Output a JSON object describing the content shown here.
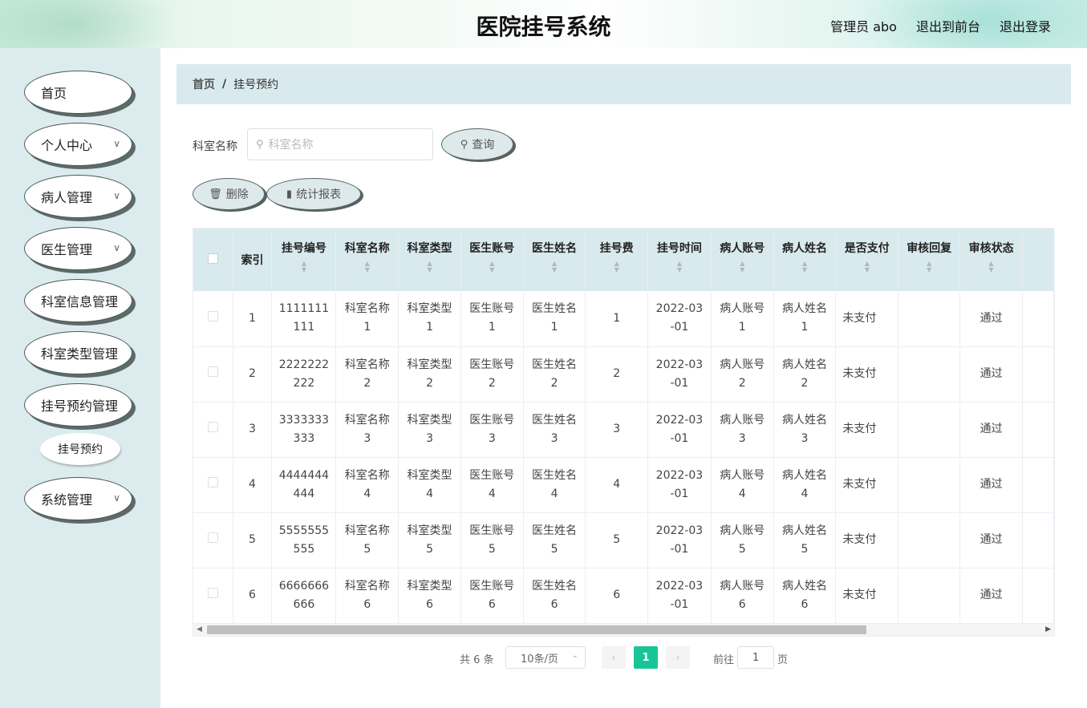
{
  "header": {
    "title": "医院挂号系统",
    "user_label": "管理员 abo",
    "front_link": "退出到前台",
    "logout_link": "退出登录"
  },
  "sidebar": {
    "items": [
      {
        "label": "首页",
        "has_children": false
      },
      {
        "label": "个人中心",
        "has_children": true
      },
      {
        "label": "病人管理",
        "has_children": true
      },
      {
        "label": "医生管理",
        "has_children": true
      },
      {
        "label": "科室信息管理",
        "has_children": false
      },
      {
        "label": "科室类型管理",
        "has_children": false
      },
      {
        "label": "挂号预约管理",
        "has_children": false
      },
      {
        "label": "系统管理",
        "has_children": true
      }
    ],
    "subitem": "挂号预约"
  },
  "breadcrumb": {
    "home": "首页",
    "sep": "/",
    "current": "挂号预约"
  },
  "search": {
    "label": "科室名称",
    "placeholder": "科室名称",
    "button": "查询"
  },
  "actions": {
    "delete": "删除",
    "report": "统计报表"
  },
  "table": {
    "columns": [
      "索引",
      "挂号编号",
      "科室名称",
      "科室类型",
      "医生账号",
      "医生姓名",
      "挂号费",
      "挂号时间",
      "病人账号",
      "病人姓名",
      "是否支付",
      "审核回复",
      "审核状态"
    ],
    "rows": [
      {
        "index": "1",
        "code": [
          "1111111",
          "111"
        ],
        "dept": [
          "科室名称",
          "1"
        ],
        "type": [
          "科室类型",
          "1"
        ],
        "doc_acc": [
          "医生账号",
          "1"
        ],
        "doc_name": [
          "医生姓名",
          "1"
        ],
        "fee": "1",
        "time": [
          "2022-03",
          "-01"
        ],
        "pat_acc": [
          "病人账号",
          "1"
        ],
        "pat_name": [
          "病人姓名",
          "1"
        ],
        "paid": "未支付",
        "reply": "",
        "status": "通过"
      },
      {
        "index": "2",
        "code": [
          "2222222",
          "222"
        ],
        "dept": [
          "科室名称",
          "2"
        ],
        "type": [
          "科室类型",
          "2"
        ],
        "doc_acc": [
          "医生账号",
          "2"
        ],
        "doc_name": [
          "医生姓名",
          "2"
        ],
        "fee": "2",
        "time": [
          "2022-03",
          "-01"
        ],
        "pat_acc": [
          "病人账号",
          "2"
        ],
        "pat_name": [
          "病人姓名",
          "2"
        ],
        "paid": "未支付",
        "reply": "",
        "status": "通过"
      },
      {
        "index": "3",
        "code": [
          "3333333",
          "333"
        ],
        "dept": [
          "科室名称",
          "3"
        ],
        "type": [
          "科室类型",
          "3"
        ],
        "doc_acc": [
          "医生账号",
          "3"
        ],
        "doc_name": [
          "医生姓名",
          "3"
        ],
        "fee": "3",
        "time": [
          "2022-03",
          "-01"
        ],
        "pat_acc": [
          "病人账号",
          "3"
        ],
        "pat_name": [
          "病人姓名",
          "3"
        ],
        "paid": "未支付",
        "reply": "",
        "status": "通过"
      },
      {
        "index": "4",
        "code": [
          "4444444",
          "444"
        ],
        "dept": [
          "科室名称",
          "4"
        ],
        "type": [
          "科室类型",
          "4"
        ],
        "doc_acc": [
          "医生账号",
          "4"
        ],
        "doc_name": [
          "医生姓名",
          "4"
        ],
        "fee": "4",
        "time": [
          "2022-03",
          "-01"
        ],
        "pat_acc": [
          "病人账号",
          "4"
        ],
        "pat_name": [
          "病人姓名",
          "4"
        ],
        "paid": "未支付",
        "reply": "",
        "status": "通过"
      },
      {
        "index": "5",
        "code": [
          "5555555",
          "555"
        ],
        "dept": [
          "科室名称",
          "5"
        ],
        "type": [
          "科室类型",
          "5"
        ],
        "doc_acc": [
          "医生账号",
          "5"
        ],
        "doc_name": [
          "医生姓名",
          "5"
        ],
        "fee": "5",
        "time": [
          "2022-03",
          "-01"
        ],
        "pat_acc": [
          "病人账号",
          "5"
        ],
        "pat_name": [
          "病人姓名",
          "5"
        ],
        "paid": "未支付",
        "reply": "",
        "status": "通过"
      },
      {
        "index": "6",
        "code": [
          "6666666",
          "666"
        ],
        "dept": [
          "科室名称",
          "6"
        ],
        "type": [
          "科室类型",
          "6"
        ],
        "doc_acc": [
          "医生账号",
          "6"
        ],
        "doc_name": [
          "医生姓名",
          "6"
        ],
        "fee": "6",
        "time": [
          "2022-03",
          "-01"
        ],
        "pat_acc": [
          "病人账号",
          "6"
        ],
        "pat_name": [
          "病人姓名",
          "6"
        ],
        "paid": "未支付",
        "reply": "",
        "status": "通过"
      }
    ]
  },
  "pagination": {
    "total": "共 6 条",
    "page_size": "10条/页",
    "prev": "‹",
    "current_page": "1",
    "next": "›",
    "goto_label": "前往",
    "goto_value": "1",
    "goto_unit": "页"
  },
  "colors": {
    "accent": "#19c596",
    "sidebar_bg": "#dcecee",
    "header_row_bg": "#d9eaee"
  }
}
